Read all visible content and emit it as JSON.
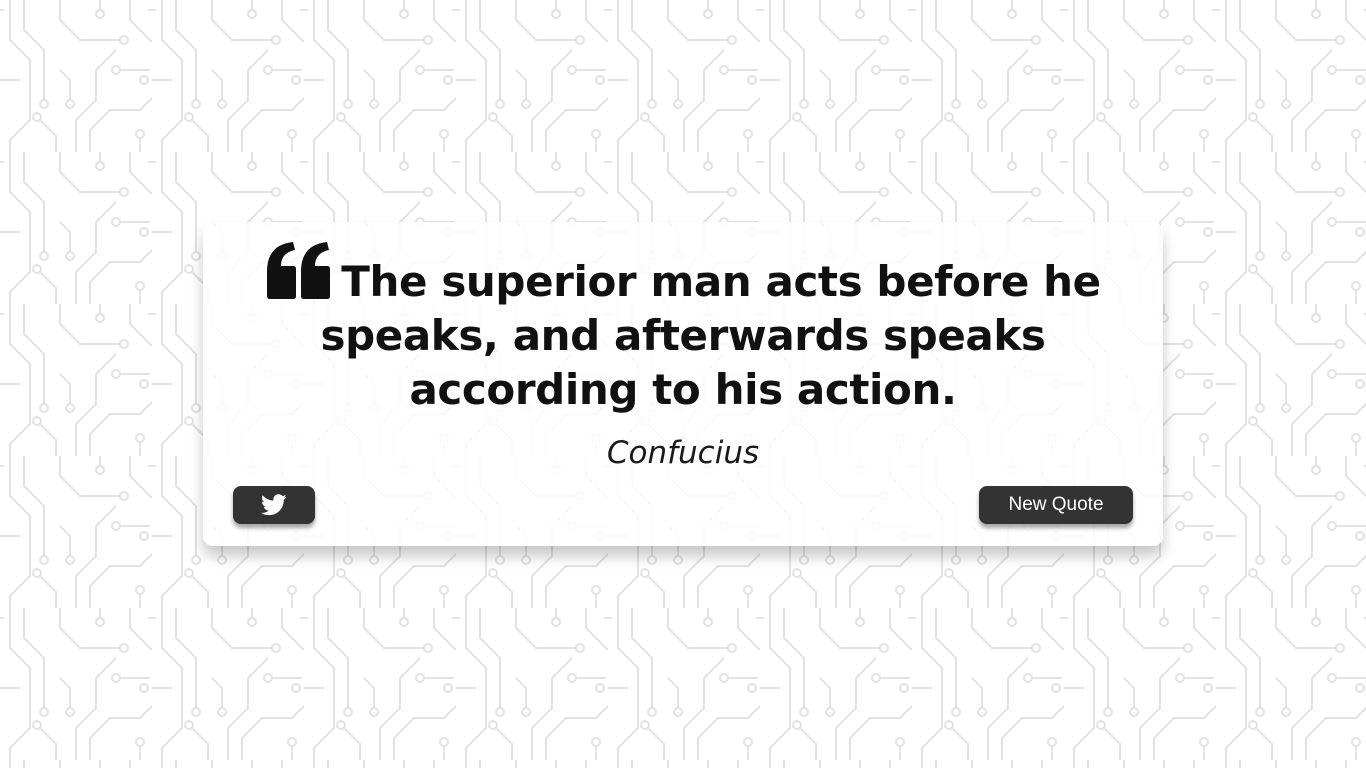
{
  "quote": {
    "text": "The superior man acts before he speaks, and afterwards speaks according to his action.",
    "author": "Confucius",
    "icon": "quote-left-icon"
  },
  "actions": {
    "tweet_icon": "twitter-icon",
    "new_quote_label": "New Quote"
  },
  "colors": {
    "background": "#ffffff",
    "pattern_line": "#e4e4e4",
    "card": "#ffffff",
    "text": "#111111",
    "button": "#333333",
    "button_text": "#ffffff"
  }
}
